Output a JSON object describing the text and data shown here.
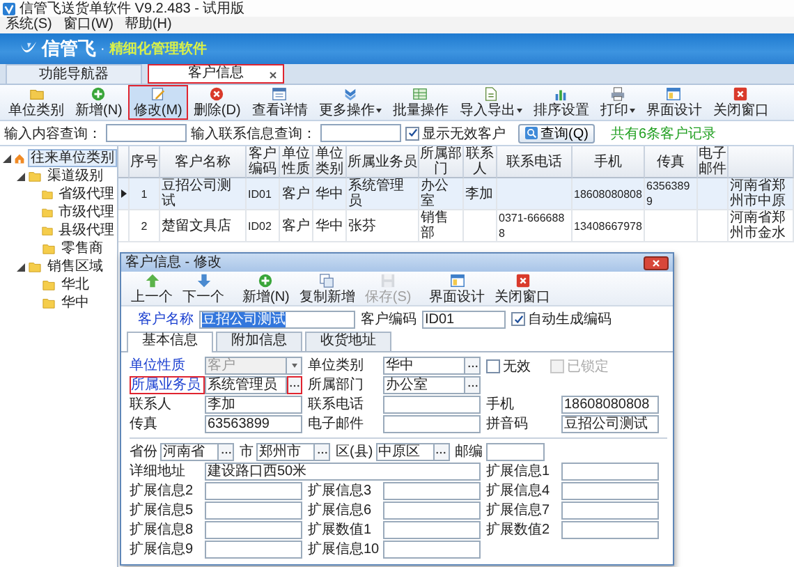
{
  "window": {
    "title": "信管飞送货单软件 V9.2.483 - 试用版"
  },
  "menu": [
    {
      "label": "系统(S)"
    },
    {
      "label": "窗口(W)"
    },
    {
      "label": "帮助(H)"
    }
  ],
  "banner": {
    "brand": "信管飞",
    "separator": "·",
    "slogan": "精细化管理软件"
  },
  "tabs": [
    {
      "label": "功能导航器",
      "selected": false
    },
    {
      "label": "客户信息",
      "selected": true,
      "closable": true
    }
  ],
  "toolbar": [
    {
      "label": "单位类别",
      "selected": false
    },
    {
      "label": "新增(N)",
      "selected": false
    },
    {
      "label": "修改(M)",
      "selected": true
    },
    {
      "label": "删除(D)",
      "selected": false
    },
    {
      "label": "查看详情",
      "selected": false
    },
    {
      "label": "更多操作",
      "selected": false,
      "dropdown": true
    },
    {
      "label": "批量操作",
      "selected": false
    },
    {
      "label": "导入导出",
      "selected": false,
      "dropdown": true
    },
    {
      "label": "排序设置",
      "selected": false
    },
    {
      "label": "打印",
      "selected": false,
      "dropdown": true
    },
    {
      "label": "界面设计",
      "selected": false
    },
    {
      "label": "关闭窗口",
      "selected": false
    }
  ],
  "search": {
    "content_label": "输入内容查询：",
    "contact_label": "输入联系信息查询：",
    "show_invalid": {
      "label": "显示无效客户",
      "checked": true
    },
    "button": "查询(Q)",
    "summary": "共有6条客户记录"
  },
  "tree": [
    {
      "label": "往来单位类别",
      "selected": true,
      "expanded": true,
      "children": [
        {
          "label": "渠道级别",
          "selected": false,
          "expanded": true,
          "children": [
            {
              "label": "省级代理",
              "selected": false
            },
            {
              "label": "市级代理",
              "selected": false
            },
            {
              "label": "县级代理",
              "selected": false
            },
            {
              "label": "零售商",
              "selected": false
            }
          ]
        },
        {
          "label": "销售区域",
          "selected": false,
          "expanded": true,
          "children": [
            {
              "label": "华北",
              "selected": false
            },
            {
              "label": "华中",
              "selected": false
            }
          ]
        }
      ]
    }
  ],
  "table": {
    "columns": [
      "序号",
      "客户名称",
      "客户编码",
      "单位性质",
      "单位类别",
      "所属业务员",
      "所属部门",
      "联系人",
      "联系电话",
      "手机",
      "传真",
      "电子邮件"
    ],
    "rows": [
      {
        "selected": true,
        "cells": [
          "1",
          "豆招公司测试",
          "ID01",
          "客户",
          "华中",
          "系统管理员",
          "办公室",
          "李加",
          null,
          "18608080808",
          "63563899",
          null,
          "河南省郑州市中原"
        ]
      },
      {
        "selected": false,
        "cells": [
          "2",
          "楚留文具店",
          "ID02",
          "客户",
          "华中",
          "张芬",
          "销售部",
          null,
          "0371-6666888",
          "13408667978",
          null,
          null,
          "河南省郑州市金水"
        ]
      }
    ]
  },
  "dialog": {
    "title": "客户信息 - 修改",
    "toolbar": [
      {
        "label": "上一个",
        "disabled": false
      },
      {
        "label": "下一个",
        "disabled": false
      },
      {
        "label": "新增(N)",
        "disabled": false
      },
      {
        "label": "复制新增",
        "disabled": false
      },
      {
        "label": "保存(S)",
        "disabled": true
      },
      {
        "label": "界面设计",
        "disabled": false
      },
      {
        "label": "关闭窗口",
        "disabled": false
      }
    ],
    "name_field": {
      "label": "客户名称",
      "value": "豆招公司测试",
      "text_selected": true
    },
    "code_field": {
      "label": "客户编码",
      "value": "ID01"
    },
    "auto_code": {
      "label": "自动生成编码",
      "checked": true
    },
    "tabs": [
      {
        "label": "基本信息",
        "selected": true
      },
      {
        "label": "附加信息",
        "selected": false
      },
      {
        "label": "收货地址",
        "selected": false
      }
    ],
    "form_rows": [
      {
        "items": [
          {
            "kind": "select",
            "label": "单位性质",
            "value": "客户",
            "required": true,
            "disabled": true
          },
          {
            "kind": "picker",
            "label": "单位类别",
            "value": "华中"
          },
          {
            "kind": "check",
            "label": "无效",
            "checked": false,
            "disabled": false
          },
          {
            "kind": "check",
            "label": "已锁定",
            "checked": false,
            "disabled": true
          }
        ]
      },
      {
        "items": [
          {
            "kind": "picker",
            "label": "所属业务员",
            "value": "系统管理员",
            "required": true,
            "highlighted": true
          },
          {
            "kind": "picker",
            "label": "所属部门",
            "value": "办公室"
          }
        ]
      },
      {
        "items": [
          {
            "kind": "field",
            "label": "联系人",
            "value": "李加"
          },
          {
            "kind": "field",
            "label": "联系电话"
          },
          {
            "kind": "field",
            "label": "手机",
            "value": "18608080808"
          }
        ]
      },
      {
        "items": [
          {
            "kind": "field",
            "label": "传真",
            "value": "63563899"
          },
          {
            "kind": "field",
            "label": "电子邮件"
          },
          {
            "kind": "field",
            "label": "拼音码",
            "value": "豆招公司测试"
          }
        ]
      },
      {
        "divider_before": true,
        "compact": true,
        "items": [
          {
            "kind": "picker",
            "label": "省份",
            "value": "河南省"
          },
          {
            "kind": "picker",
            "label": "市",
            "value": "郑州市"
          },
          {
            "kind": "picker",
            "label": "区(县)",
            "value": "中原区"
          },
          {
            "kind": "field",
            "label": "邮编"
          }
        ]
      },
      {
        "items": [
          {
            "kind": "field",
            "label": "详细地址",
            "value": "建设路口西50米",
            "wide": true
          },
          {
            "kind": "field",
            "label": "扩展信息1"
          }
        ]
      },
      {
        "items": [
          {
            "kind": "field",
            "label": "扩展信息2"
          },
          {
            "kind": "field",
            "label": "扩展信息3"
          },
          {
            "kind": "field",
            "label": "扩展信息4"
          }
        ]
      },
      {
        "items": [
          {
            "kind": "field",
            "label": "扩展信息5"
          },
          {
            "kind": "field",
            "label": "扩展信息6"
          },
          {
            "kind": "field",
            "label": "扩展信息7"
          }
        ]
      },
      {
        "items": [
          {
            "kind": "field",
            "label": "扩展信息8"
          },
          {
            "kind": "field",
            "label": "扩展数值1"
          },
          {
            "kind": "field",
            "label": "扩展数值2"
          }
        ]
      },
      {
        "items": [
          {
            "kind": "field",
            "label": "扩展信息9"
          },
          {
            "kind": "field",
            "label": "扩展信息10"
          }
        ]
      }
    ]
  }
}
